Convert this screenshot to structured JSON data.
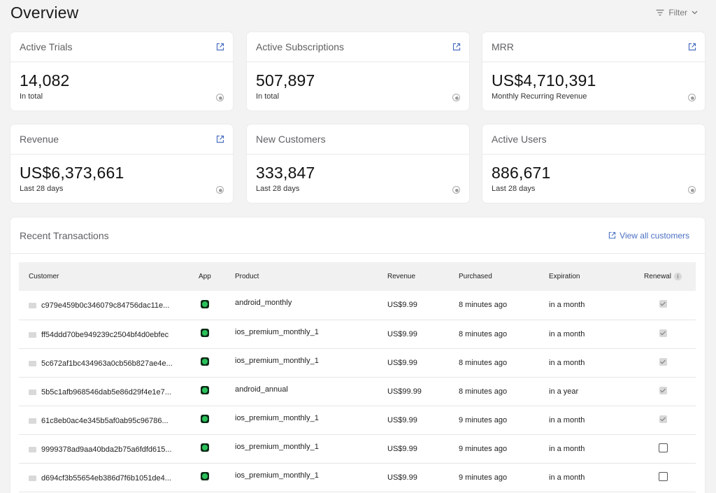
{
  "page": {
    "title": "Overview"
  },
  "filter": {
    "label": "Filter"
  },
  "stats": [
    {
      "title": "Active Trials",
      "value": "14,082",
      "sub": "In total"
    },
    {
      "title": "Active Subscriptions",
      "value": "507,897",
      "sub": "In total"
    },
    {
      "title": "MRR",
      "value": "US$4,710,391",
      "sub": "Monthly Recurring Revenue"
    },
    {
      "title": "Revenue",
      "value": "US$6,373,661",
      "sub": "Last 28 days"
    },
    {
      "title": "New Customers",
      "value": "333,847",
      "sub": "Last 28 days"
    },
    {
      "title": "Active Users",
      "value": "886,671",
      "sub": "Last 28 days"
    }
  ],
  "transactions": {
    "title": "Recent Transactions",
    "view_all": "View all customers",
    "columns": [
      "Customer",
      "App",
      "Product",
      "Revenue",
      "Purchased",
      "Expiration",
      "Renewal"
    ],
    "rows": [
      {
        "customer": "c979e459b0c346079c84756dac11e...",
        "product": "android_monthly",
        "revenue": "US$9.99",
        "purchased": "8 minutes ago",
        "expiration": "in a month",
        "renewal": true
      },
      {
        "customer": "ff54ddd70be949239c2504bf4d0ebfec",
        "product": "ios_premium_monthly_1",
        "revenue": "US$9.99",
        "purchased": "8 minutes ago",
        "expiration": "in a month",
        "renewal": true
      },
      {
        "customer": "5c672af1bc434963a0cb56b827ae4e...",
        "product": "ios_premium_monthly_1",
        "revenue": "US$9.99",
        "purchased": "8 minutes ago",
        "expiration": "in a month",
        "renewal": true
      },
      {
        "customer": "5b5c1afb968546dab5e86d29f4e1e7...",
        "product": "android_annual",
        "revenue": "US$99.99",
        "purchased": "8 minutes ago",
        "expiration": "in a year",
        "renewal": true
      },
      {
        "customer": "61c8eb0ac4e345b5af0ab95c96786...",
        "product": "ios_premium_monthly_1",
        "revenue": "US$9.99",
        "purchased": "9 minutes ago",
        "expiration": "in a month",
        "renewal": true
      },
      {
        "customer": "9999378ad9aa40bda2b75a6fdfd615...",
        "product": "ios_premium_monthly_1",
        "revenue": "US$9.99",
        "purchased": "9 minutes ago",
        "expiration": "in a month",
        "renewal": false
      },
      {
        "customer": "d694cf3b55654eb386d7f6b1051de4...",
        "product": "ios_premium_monthly_1",
        "revenue": "US$9.99",
        "purchased": "9 minutes ago",
        "expiration": "in a month",
        "renewal": false
      }
    ]
  },
  "colors": {
    "accent": "#4a6fc2",
    "app_icon": "#29c25a",
    "background": "#f3f3f4"
  }
}
